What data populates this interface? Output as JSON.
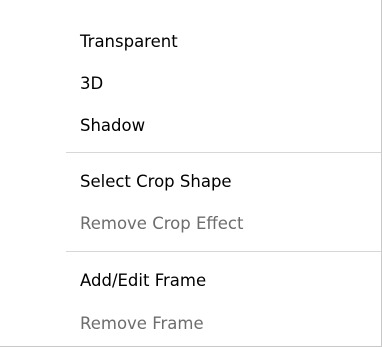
{
  "menu": {
    "items": [
      {
        "label": "Transparent",
        "enabled": true
      },
      {
        "label": "3D",
        "enabled": true
      },
      {
        "label": "Shadow",
        "enabled": true
      },
      {
        "label": "Select Crop Shape",
        "enabled": true
      },
      {
        "label": "Remove Crop Effect",
        "enabled": false
      },
      {
        "label": "Add/Edit Frame",
        "enabled": true
      },
      {
        "label": "Remove Frame",
        "enabled": false
      }
    ]
  },
  "colors": {
    "enabled_text": "#000000",
    "disabled_text": "#6d6d6d",
    "separator": "#d7d7d7",
    "background": "#ffffff"
  }
}
